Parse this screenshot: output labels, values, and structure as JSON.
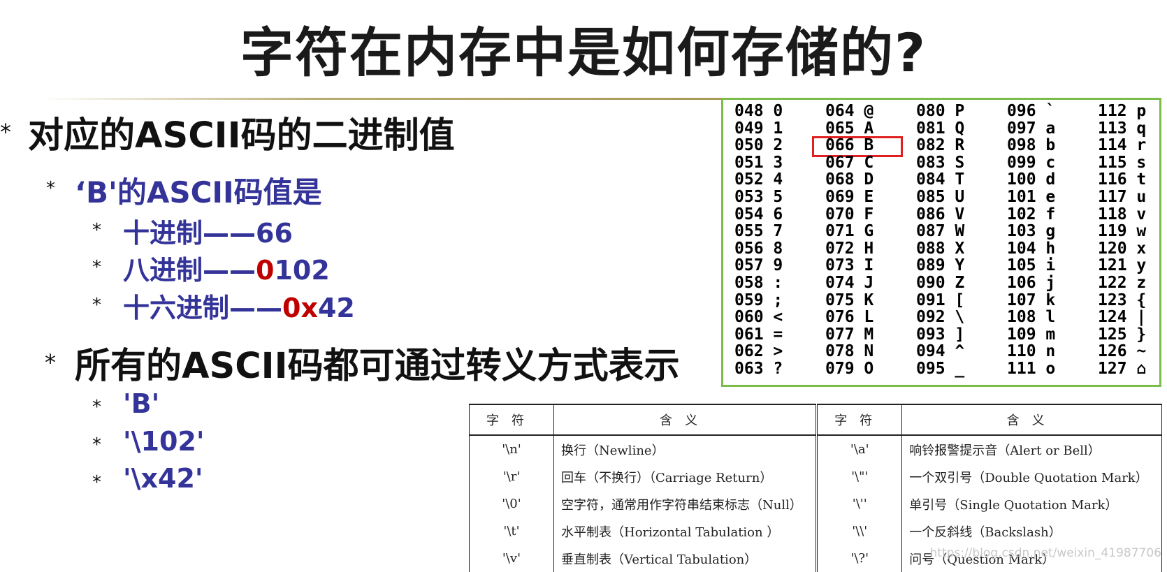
{
  "title": "字符在内存中是如何存储的?",
  "bullets": {
    "b1": "对应的ASCII码的二进制值",
    "b1_sub": "‘B'的ASCII码值是",
    "dec_label": "十进制——",
    "dec_value": "66",
    "oct_label": "八进制——",
    "oct_prefix": "0",
    "oct_value": "102",
    "hex_label": "十六进制——",
    "hex_prefix": "0x",
    "hex_value": "42",
    "b2": "所有的ASCII码都可通过转义方式表示",
    "ex1": "'B'",
    "ex2": "'\\102'",
    "ex3": "'\\x42'"
  },
  "ascii_table": {
    "columns": [
      [
        "048 0",
        "049 1",
        "050 2",
        "051 3",
        "052 4",
        "053 5",
        "054 6",
        "055 7",
        "056 8",
        "057 9",
        "058 :",
        "059 ;",
        "060 <",
        "061 =",
        "062 >",
        "063 ?"
      ],
      [
        "064 @",
        "065 A",
        "066 B",
        "067 C",
        "068 D",
        "069 E",
        "070 F",
        "071 G",
        "072 H",
        "073 I",
        "074 J",
        "075 K",
        "076 L",
        "077 M",
        "078 N",
        "079 O"
      ],
      [
        "080 P",
        "081 Q",
        "082 R",
        "083 S",
        "084 T",
        "085 U",
        "086 V",
        "087 W",
        "088 X",
        "089 Y",
        "090 Z",
        "091 [",
        "092 \\",
        "093 ]",
        "094 ^",
        "095 _"
      ],
      [
        "096 `",
        "097 a",
        "098 b",
        "099 c",
        "100 d",
        "101 e",
        "102 f",
        "103 g",
        "104 h",
        "105 i",
        "106 j",
        "107 k",
        "108 l",
        "109 m",
        "110 n",
        "111 o"
      ],
      [
        "112 p",
        "113 q",
        "114 r",
        "115 s",
        "116 t",
        "117 u",
        "118 v",
        "119 w",
        "120 x",
        "121 y",
        "122 z",
        "123 {",
        "124 |",
        "125 }",
        "126 ~",
        "127 ⌂"
      ]
    ],
    "highlighted": "066 B"
  },
  "escape_table": {
    "headers": [
      "字符",
      "含义",
      "字符",
      "含义"
    ],
    "rows": [
      [
        "'\\n'",
        "换行（Newline）",
        "'\\a'",
        "响铃报警提示音（Alert or Bell）"
      ],
      [
        "'\\r'",
        "回车（不换行）（Carriage Return）",
        "'\\\"'",
        "一个双引号（Double Quotation Mark）"
      ],
      [
        "'\\0'",
        "空字符，通常用作字符串结束标志（Null）",
        "'\\''",
        "单引号（Single Quotation Mark）"
      ],
      [
        "'\\t'",
        "水平制表（Horizontal Tabulation ）",
        "'\\\\'",
        "一个反斜线（Backslash）"
      ],
      [
        "'\\v'",
        "垂直制表（Vertical Tabulation）",
        "'\\?'",
        "问号（Question Mark）"
      ]
    ]
  },
  "watermark": "https://blog.csdn.net/weixin_41987706"
}
